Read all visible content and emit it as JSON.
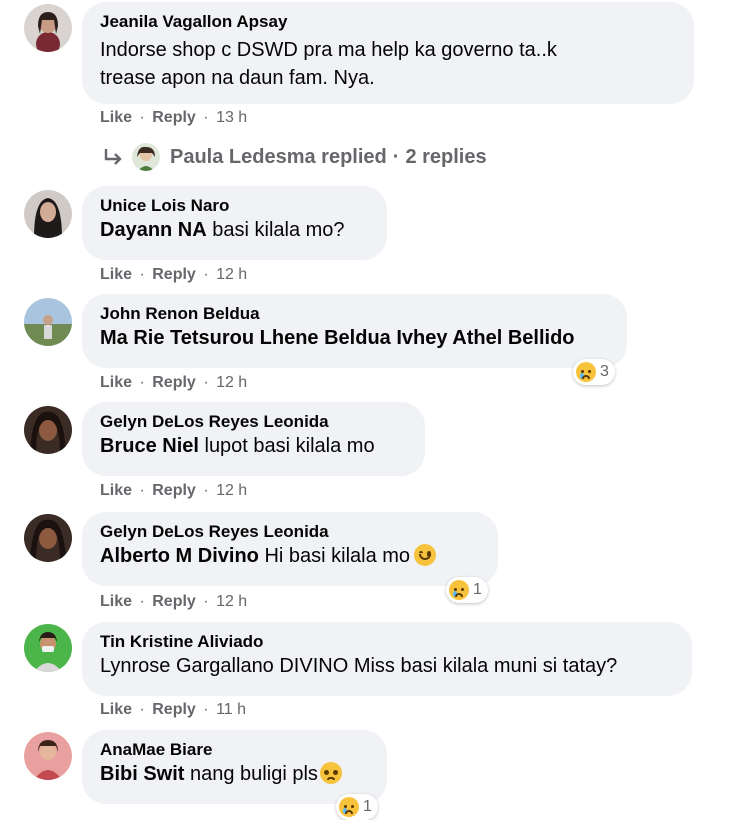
{
  "comments": [
    {
      "author": "Jeanila Vagallon Apsay",
      "lines": [
        "Indorse shop c DSWD pra ma help ka governo ta..k",
        "trease apon na daun fam. Nya."
      ],
      "like": "Like",
      "reply": "Reply",
      "time": "13 h",
      "replies": {
        "name": "Paula Ledesma replied",
        "sep": "·",
        "count": "2 replies"
      }
    },
    {
      "author": "Unice Lois Naro",
      "tag": "Dayann NA",
      "text": " basi kilala mo?",
      "like": "Like",
      "reply": "Reply",
      "time": "12 h"
    },
    {
      "author": "John Renon Beldua",
      "tag": "Ma Rie Tetsurou Lhene Beldua Ivhey Athel Bellido",
      "text": "",
      "like": "Like",
      "reply": "Reply",
      "time": "12 h",
      "reaction_count": "3"
    },
    {
      "author": "Gelyn DeLos Reyes Leonida",
      "tag": "Bruce Niel",
      "text": " lupot basi kilala mo",
      "like": "Like",
      "reply": "Reply",
      "time": "12 h"
    },
    {
      "author": "Gelyn DeLos Reyes Leonida",
      "tag": "Alberto M Divino",
      "text": " Hi basi kilala mo",
      "like": "Like",
      "reply": "Reply",
      "time": "12 h",
      "reaction_count": "1"
    },
    {
      "author": "Tin Kristine Aliviado",
      "text": "Lynrose Gargallano DIVINO Miss basi kilala muni si tatay?",
      "like": "Like",
      "reply": "Reply",
      "time": "11 h"
    },
    {
      "author": "AnaMae Biare",
      "tag": "Bibi Swit",
      "text": " nang buligi pls",
      "reaction_count": "1"
    }
  ],
  "separator": "·"
}
